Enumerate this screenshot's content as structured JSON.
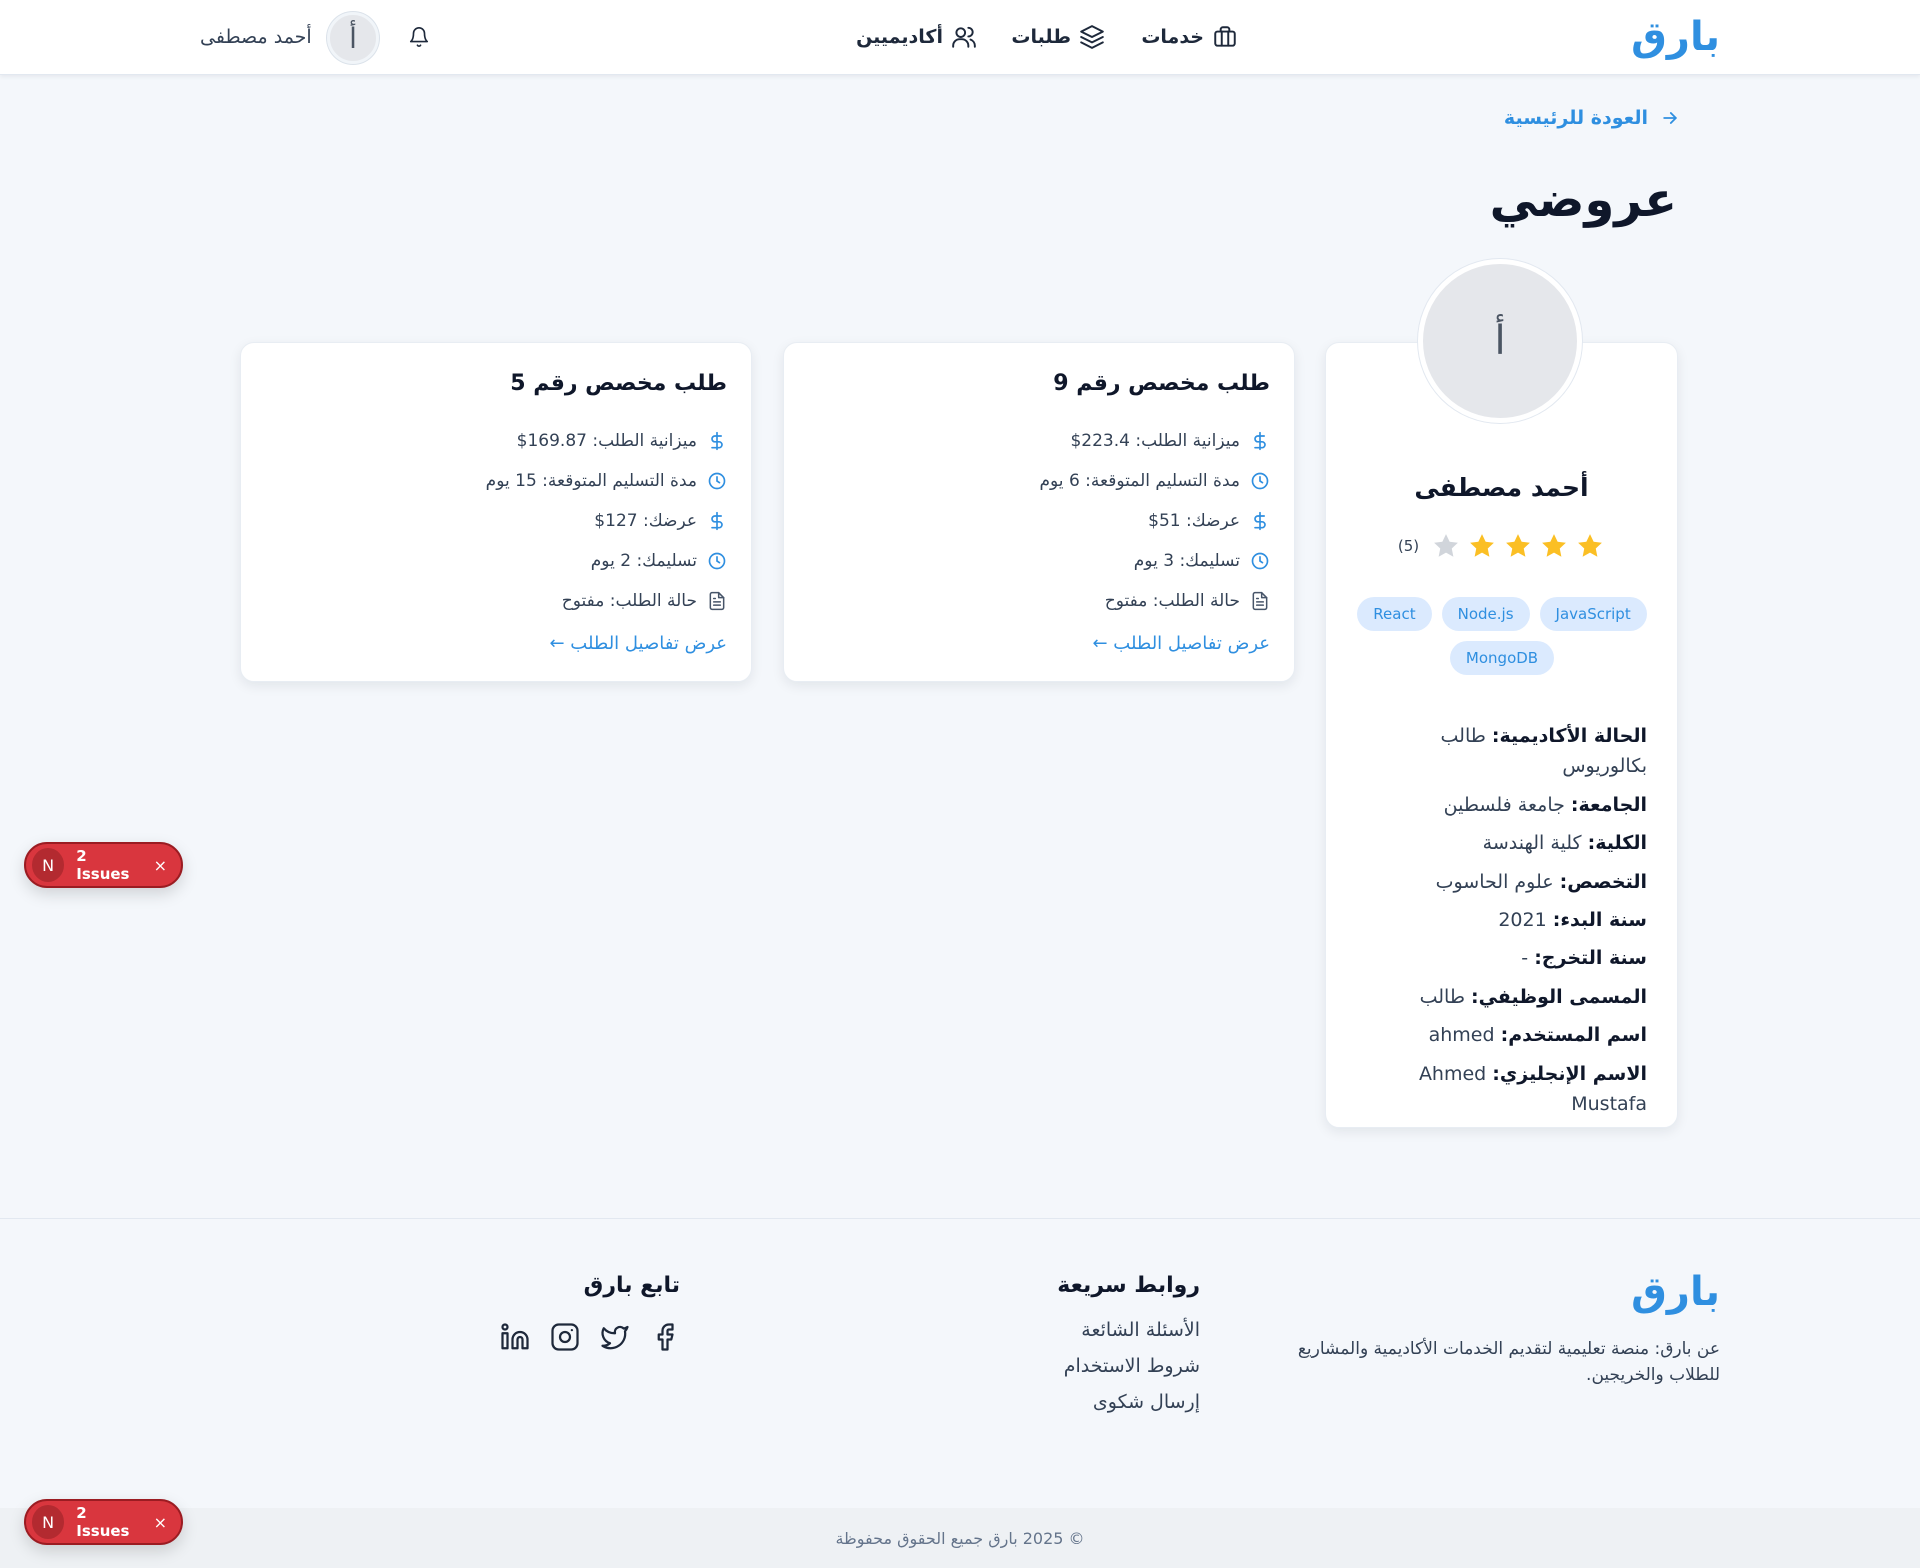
{
  "header": {
    "logo": "بارق",
    "nav": [
      {
        "label": "خدمات",
        "icon": "briefcase-icon"
      },
      {
        "label": "طلبات",
        "icon": "layers-icon"
      },
      {
        "label": "أكاديميين",
        "icon": "users-icon"
      }
    ],
    "user_initial": "أ",
    "user_name": "أحمد مصطفى"
  },
  "back_link": "العودة للرئيسية",
  "page_title": "عروضي",
  "profile": {
    "initial": "أ",
    "name": "أحمد مصطفى",
    "rating": 4,
    "rating_max": 5,
    "rating_count": "(5)",
    "skills": [
      "React",
      "Node.js",
      "JavaScript",
      "MongoDB"
    ],
    "info": [
      {
        "label": "الحالة الأكاديمية:",
        "value": "طالب بكالوريوس"
      },
      {
        "label": "الجامعة:",
        "value": "جامعة فلسطين"
      },
      {
        "label": "الكلية:",
        "value": "كلية الهندسة"
      },
      {
        "label": "التخصص:",
        "value": "علوم الحاسوب"
      },
      {
        "label": "سنة البدء:",
        "value": "2021"
      },
      {
        "label": "سنة التخرج:",
        "value": "-"
      },
      {
        "label": "المسمى الوظيفي:",
        "value": "طالب"
      },
      {
        "label": "اسم المستخدم:",
        "value": "ahmed"
      },
      {
        "label": "الاسم الإنجليزي:",
        "value": "Ahmed Mustafa"
      }
    ]
  },
  "offers": [
    {
      "title": "طلب مخصص رقم 9",
      "rows": [
        {
          "icon": "dollar-icon",
          "text": "ميزانية الطلب: 223.4$"
        },
        {
          "icon": "clock-icon",
          "text": "مدة التسليم المتوقعة: 6 يوم"
        },
        {
          "icon": "dollar-icon",
          "text": "عرضك: 51$"
        },
        {
          "icon": "clock-icon",
          "text": "تسليمك: 3 يوم"
        },
        {
          "icon": "file-icon",
          "text": "حالة الطلب: مفتوح"
        }
      ],
      "link": "عرض تفاصيل الطلب ←"
    },
    {
      "title": "طلب مخصص رقم 5",
      "rows": [
        {
          "icon": "dollar-icon",
          "text": "ميزانية الطلب: 169.87$"
        },
        {
          "icon": "clock-icon",
          "text": "مدة التسليم المتوقعة: 15 يوم"
        },
        {
          "icon": "dollar-icon",
          "text": "عرضك: 127$"
        },
        {
          "icon": "clock-icon",
          "text": "تسليمك: 2 يوم"
        },
        {
          "icon": "file-icon",
          "text": "حالة الطلب: مفتوح"
        }
      ],
      "link": "عرض تفاصيل الطلب ←"
    }
  ],
  "footer": {
    "logo": "بارق",
    "about": "عن بارق: منصة تعليمية لتقديم الخدمات الأكاديمية والمشاريع للطلاب والخريجين.",
    "links_heading": "روابط سريعة",
    "links": [
      "الأسئلة الشائعة",
      "شروط الاستخدام",
      "إرسال شكوى"
    ],
    "follow_heading": "تابع بارق",
    "socials": [
      "facebook-icon",
      "twitter-icon",
      "instagram-icon",
      "linkedin-icon"
    ],
    "copyright": "© 2025 بارق جميع الحقوق محفوظة"
  },
  "issues_badge": {
    "letter": "N",
    "label": "2 Issues",
    "close": "×"
  },
  "colors": {
    "accent": "#2f8fe0",
    "star": "#fbbf24",
    "star_empty": "#d1d5db",
    "issues": "#d9363e"
  }
}
